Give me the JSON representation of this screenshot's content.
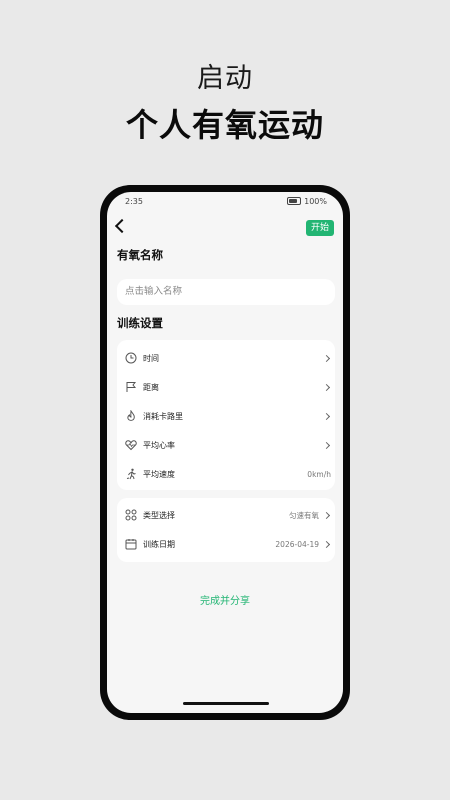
{
  "hero": {
    "subtitle": "启动",
    "title": "个人有氧运动"
  },
  "status": {
    "time": "2:35",
    "battery": "100%"
  },
  "nav": {
    "start_label": "开始"
  },
  "form": {
    "name_section_title": "有氧名称",
    "name_placeholder": "点击输入名称",
    "training_section_title": "训练设置"
  },
  "settings": [
    {
      "icon": "clock-icon",
      "label": "时间",
      "value": ""
    },
    {
      "icon": "flag-icon",
      "label": "距离",
      "value": ""
    },
    {
      "icon": "flame-icon",
      "label": "消耗卡路里",
      "value": ""
    },
    {
      "icon": "heart-rate-icon",
      "label": "平均心率",
      "value": ""
    },
    {
      "icon": "running-icon",
      "label": "平均速度",
      "value": "0km/h"
    }
  ],
  "extra": [
    {
      "icon": "grid-icon",
      "label": "类型选择",
      "value": "匀速有氧"
    },
    {
      "icon": "calendar-icon",
      "label": "训练日期",
      "value": "2026-04-19"
    }
  ],
  "actions": {
    "finish_share": "完成并分享"
  },
  "colors": {
    "accent": "#22b573",
    "background": "#e9e9e9",
    "card": "#ffffff"
  }
}
